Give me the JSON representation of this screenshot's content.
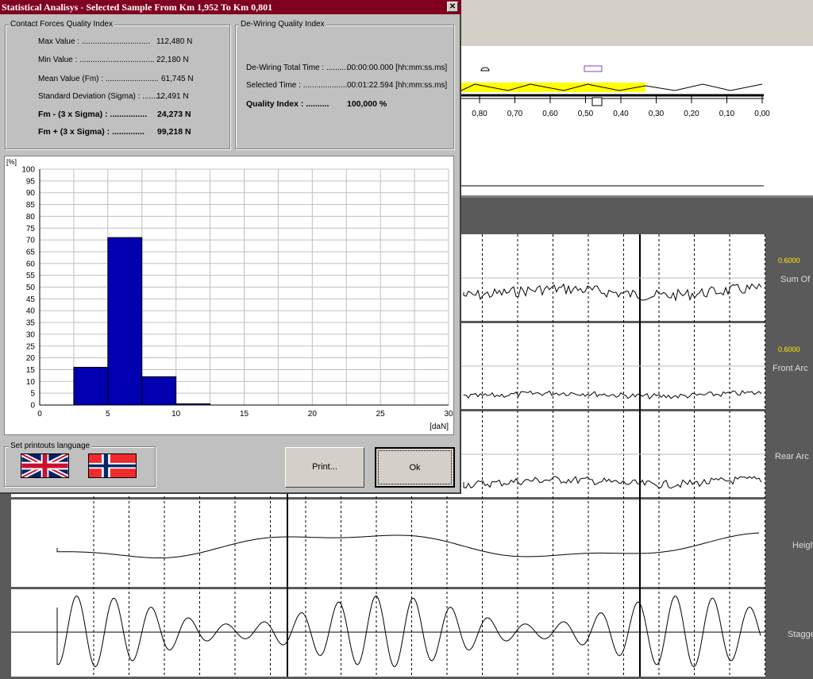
{
  "dialog": {
    "title": "Statistical Analisys - Selected Sample From Km 1,952  To Km 0,801",
    "close_label": "✕",
    "contact": {
      "label": "Contact Forces Quality Index",
      "rows": [
        {
          "name": "Max Value : ...............................",
          "value": "112,480 N"
        },
        {
          "name": "Min Value : ..................................",
          "value": "22,180 N"
        },
        {
          "name": "Mean Value (Fm) : ........................",
          "value": "61,745 N"
        },
        {
          "name": "Standard Deviation (Sigma) : .........",
          "value": "12,491 N"
        }
      ],
      "bold_rows": [
        {
          "name": "Fm - (3 x Sigma) : ................",
          "value": "24,273 N"
        },
        {
          "name": "Fm + (3 x Sigma) : ..............",
          "value": "99,218 N"
        }
      ]
    },
    "dewiring": {
      "label": "De-Wiring Quality Index",
      "total_time_label": "De-Wiring Total Time : ..........",
      "total_time_value": "00:00:00.000 [hh:mm:ss.ms]",
      "selected_time_label": "Selected Time : ....................",
      "selected_time_value": "00:01:22.594 [hh:mm:ss.ms]",
      "quality_label": "Quality Index : ..........",
      "quality_value": "100,000 %"
    },
    "printouts": {
      "label": "Set printouts language",
      "flags": [
        "uk-flag",
        "norway-flag"
      ]
    },
    "print_button": "Print...",
    "ok_button": "Ok"
  },
  "chart_data": {
    "type": "bar",
    "ylabel": "[%]",
    "xlabel": "[daN]",
    "ylim": [
      0,
      100
    ],
    "xlim": [
      0,
      30
    ],
    "y_ticks": [
      "0",
      "5",
      "10",
      "15",
      "20",
      "25",
      "30",
      "35",
      "40",
      "45",
      "50",
      "55",
      "60",
      "65",
      "70",
      "75",
      "80",
      "85",
      "90",
      "95",
      "100"
    ],
    "x_ticks": [
      "0",
      "5",
      "10",
      "15",
      "20",
      "25",
      "30"
    ],
    "bins": [
      {
        "from": 2.5,
        "to": 5.0,
        "value": 16
      },
      {
        "from": 5.0,
        "to": 7.5,
        "value": 71
      },
      {
        "from": 7.5,
        "to": 10.0,
        "value": 12
      },
      {
        "from": 10.0,
        "to": 12.5,
        "value": 0.5
      }
    ],
    "bar_color": "#0000b0",
    "grid": true
  },
  "background": {
    "km_ticks": [
      "0,80",
      "0,70",
      "0,60",
      "0,50",
      "0,40",
      "0,30",
      "0,20",
      "0,10",
      "0,00"
    ],
    "channels": [
      {
        "label": "Sum Of",
        "value": "0.6000"
      },
      {
        "label": "Front Arc",
        "value": "0.6000"
      },
      {
        "label": "Rear Arc",
        "value": ""
      },
      {
        "label": "Heigh",
        "value": ""
      },
      {
        "label": "Stagge",
        "value": ""
      }
    ],
    "height_axis": {
      "top": "6500.0",
      "unit": "mm",
      "bottom": "4300.0"
    },
    "stagger_axis": {
      "top": "300.0",
      "unit": "mm",
      "bottom": "-300.0"
    },
    "highlight_color": "#ffff00"
  }
}
